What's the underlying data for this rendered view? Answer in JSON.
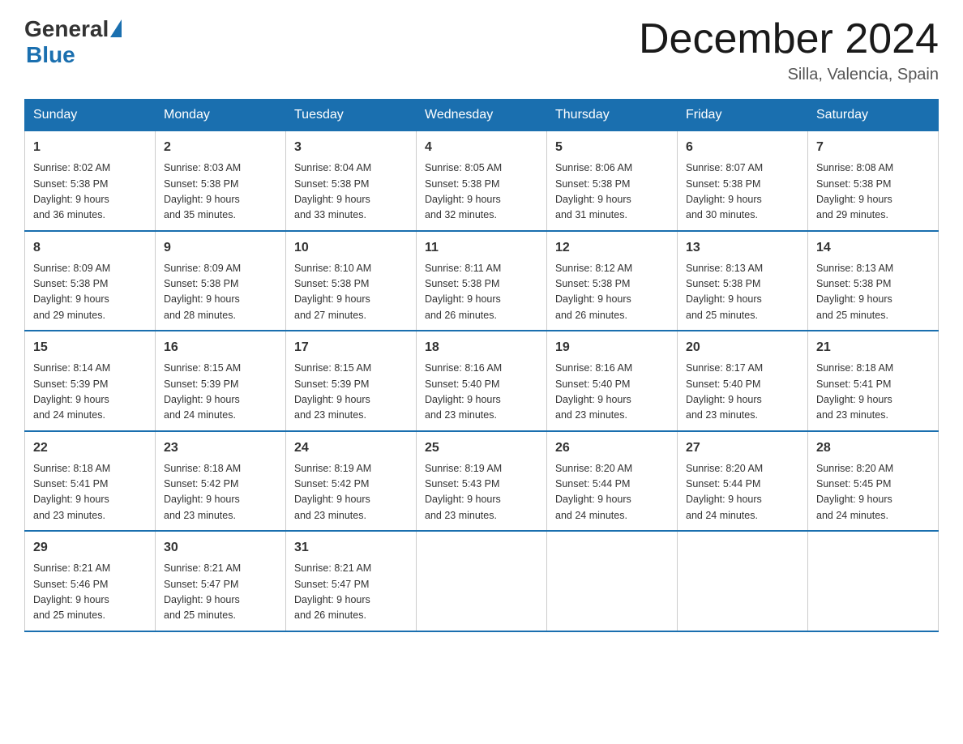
{
  "logo": {
    "general_text": "General",
    "blue_text": "Blue"
  },
  "title": "December 2024",
  "location": "Silla, Valencia, Spain",
  "days_of_week": [
    "Sunday",
    "Monday",
    "Tuesday",
    "Wednesday",
    "Thursday",
    "Friday",
    "Saturday"
  ],
  "weeks": [
    [
      {
        "day": "1",
        "sunrise": "8:02 AM",
        "sunset": "5:38 PM",
        "daylight": "9 hours and 36 minutes."
      },
      {
        "day": "2",
        "sunrise": "8:03 AM",
        "sunset": "5:38 PM",
        "daylight": "9 hours and 35 minutes."
      },
      {
        "day": "3",
        "sunrise": "8:04 AM",
        "sunset": "5:38 PM",
        "daylight": "9 hours and 33 minutes."
      },
      {
        "day": "4",
        "sunrise": "8:05 AM",
        "sunset": "5:38 PM",
        "daylight": "9 hours and 32 minutes."
      },
      {
        "day": "5",
        "sunrise": "8:06 AM",
        "sunset": "5:38 PM",
        "daylight": "9 hours and 31 minutes."
      },
      {
        "day": "6",
        "sunrise": "8:07 AM",
        "sunset": "5:38 PM",
        "daylight": "9 hours and 30 minutes."
      },
      {
        "day": "7",
        "sunrise": "8:08 AM",
        "sunset": "5:38 PM",
        "daylight": "9 hours and 29 minutes."
      }
    ],
    [
      {
        "day": "8",
        "sunrise": "8:09 AM",
        "sunset": "5:38 PM",
        "daylight": "9 hours and 29 minutes."
      },
      {
        "day": "9",
        "sunrise": "8:09 AM",
        "sunset": "5:38 PM",
        "daylight": "9 hours and 28 minutes."
      },
      {
        "day": "10",
        "sunrise": "8:10 AM",
        "sunset": "5:38 PM",
        "daylight": "9 hours and 27 minutes."
      },
      {
        "day": "11",
        "sunrise": "8:11 AM",
        "sunset": "5:38 PM",
        "daylight": "9 hours and 26 minutes."
      },
      {
        "day": "12",
        "sunrise": "8:12 AM",
        "sunset": "5:38 PM",
        "daylight": "9 hours and 26 minutes."
      },
      {
        "day": "13",
        "sunrise": "8:13 AM",
        "sunset": "5:38 PM",
        "daylight": "9 hours and 25 minutes."
      },
      {
        "day": "14",
        "sunrise": "8:13 AM",
        "sunset": "5:38 PM",
        "daylight": "9 hours and 25 minutes."
      }
    ],
    [
      {
        "day": "15",
        "sunrise": "8:14 AM",
        "sunset": "5:39 PM",
        "daylight": "9 hours and 24 minutes."
      },
      {
        "day": "16",
        "sunrise": "8:15 AM",
        "sunset": "5:39 PM",
        "daylight": "9 hours and 24 minutes."
      },
      {
        "day": "17",
        "sunrise": "8:15 AM",
        "sunset": "5:39 PM",
        "daylight": "9 hours and 23 minutes."
      },
      {
        "day": "18",
        "sunrise": "8:16 AM",
        "sunset": "5:40 PM",
        "daylight": "9 hours and 23 minutes."
      },
      {
        "day": "19",
        "sunrise": "8:16 AM",
        "sunset": "5:40 PM",
        "daylight": "9 hours and 23 minutes."
      },
      {
        "day": "20",
        "sunrise": "8:17 AM",
        "sunset": "5:40 PM",
        "daylight": "9 hours and 23 minutes."
      },
      {
        "day": "21",
        "sunrise": "8:18 AM",
        "sunset": "5:41 PM",
        "daylight": "9 hours and 23 minutes."
      }
    ],
    [
      {
        "day": "22",
        "sunrise": "8:18 AM",
        "sunset": "5:41 PM",
        "daylight": "9 hours and 23 minutes."
      },
      {
        "day": "23",
        "sunrise": "8:18 AM",
        "sunset": "5:42 PM",
        "daylight": "9 hours and 23 minutes."
      },
      {
        "day": "24",
        "sunrise": "8:19 AM",
        "sunset": "5:42 PM",
        "daylight": "9 hours and 23 minutes."
      },
      {
        "day": "25",
        "sunrise": "8:19 AM",
        "sunset": "5:43 PM",
        "daylight": "9 hours and 23 minutes."
      },
      {
        "day": "26",
        "sunrise": "8:20 AM",
        "sunset": "5:44 PM",
        "daylight": "9 hours and 24 minutes."
      },
      {
        "day": "27",
        "sunrise": "8:20 AM",
        "sunset": "5:44 PM",
        "daylight": "9 hours and 24 minutes."
      },
      {
        "day": "28",
        "sunrise": "8:20 AM",
        "sunset": "5:45 PM",
        "daylight": "9 hours and 24 minutes."
      }
    ],
    [
      {
        "day": "29",
        "sunrise": "8:21 AM",
        "sunset": "5:46 PM",
        "daylight": "9 hours and 25 minutes."
      },
      {
        "day": "30",
        "sunrise": "8:21 AM",
        "sunset": "5:47 PM",
        "daylight": "9 hours and 25 minutes."
      },
      {
        "day": "31",
        "sunrise": "8:21 AM",
        "sunset": "5:47 PM",
        "daylight": "9 hours and 26 minutes."
      },
      null,
      null,
      null,
      null
    ]
  ],
  "labels": {
    "sunrise": "Sunrise:",
    "sunset": "Sunset:",
    "daylight": "Daylight:"
  }
}
